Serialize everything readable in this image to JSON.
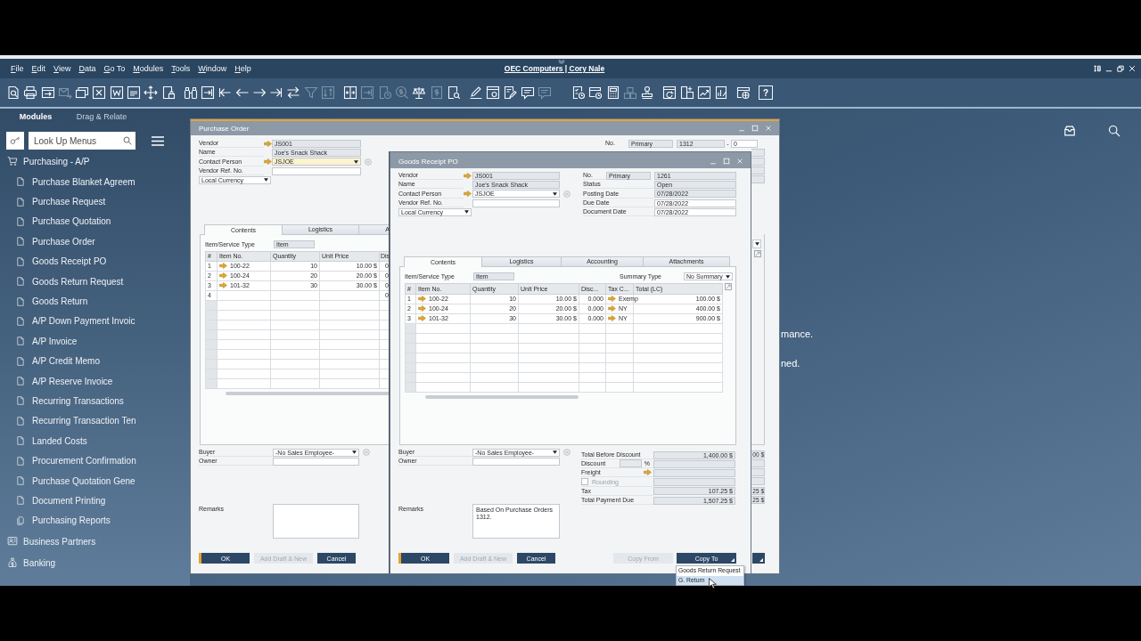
{
  "menu_bar": {
    "items": [
      "File",
      "Edit",
      "View",
      "Data",
      "Go To",
      "Modules",
      "Tools",
      "Window",
      "Help"
    ],
    "title": "OEC Computers | Cory Nale"
  },
  "toolbar": {
    "groups": [
      [
        {
          "disabled": false
        },
        {
          "disabled": false
        },
        {
          "disabled": false
        },
        {
          "disabled": true
        },
        {
          "disabled": false
        },
        {
          "disabled": false
        },
        {
          "disabled": false
        },
        {
          "disabled": false
        },
        {
          "disabled": false
        },
        {
          "disabled": false
        }
      ],
      [
        {
          "disabled": false
        },
        {
          "disabled": false
        },
        {
          "disabled": false
        },
        {
          "disabled": false
        },
        {
          "disabled": false
        },
        {
          "disabled": false
        },
        {
          "disabled": false
        },
        {
          "disabled": true
        },
        {
          "disabled": true
        }
      ],
      [
        {
          "disabled": false
        },
        {
          "disabled": true
        },
        {
          "disabled": true
        },
        {
          "disabled": true
        },
        {
          "disabled": false
        },
        {
          "disabled": true
        },
        {
          "disabled": false
        }
      ],
      [
        {
          "disabled": false
        },
        {
          "disabled": false
        },
        {
          "disabled": false
        },
        {
          "disabled": false
        },
        {
          "disabled": true
        }
      ],
      [
        {
          "disabled": false
        },
        {
          "disabled": false
        },
        {
          "disabled": false
        },
        {
          "disabled": true
        },
        {
          "disabled": false
        }
      ],
      [
        {
          "disabled": false
        },
        {
          "disabled": false
        },
        {
          "disabled": false
        },
        {
          "disabled": false
        }
      ],
      [
        {
          "disabled": false
        }
      ]
    ],
    "help": "?"
  },
  "sidebar": {
    "tabs": [
      {
        "label": "Modules",
        "selected": true
      },
      {
        "label": "Drag & Relate",
        "selected": false
      }
    ],
    "search": {
      "placeholder": "Look Up Menus"
    },
    "modules": [
      {
        "label": "Purchasing - A/P",
        "children": [
          {
            "label": "Purchase Blanket Agreem",
            "kind": "form"
          },
          {
            "label": "Purchase Request",
            "kind": "form"
          },
          {
            "label": "Purchase Quotation",
            "kind": "form"
          },
          {
            "label": "Purchase Order",
            "kind": "form"
          },
          {
            "label": "Goods Receipt PO",
            "kind": "form"
          },
          {
            "label": "Goods Return Request",
            "kind": "form"
          },
          {
            "label": "Goods Return",
            "kind": "form"
          },
          {
            "label": "A/P Down Payment Invoic",
            "kind": "form"
          },
          {
            "label": "A/P Invoice",
            "kind": "form"
          },
          {
            "label": "A/P Credit Memo",
            "kind": "form"
          },
          {
            "label": "A/P Reserve Invoice",
            "kind": "form"
          },
          {
            "label": "Recurring Transactions",
            "kind": "form"
          },
          {
            "label": "Recurring Transaction Ten",
            "kind": "form"
          },
          {
            "label": "Landed Costs",
            "kind": "form"
          },
          {
            "label": "Procurement Confirmation",
            "kind": "form"
          },
          {
            "label": "Purchase Quotation Gene",
            "kind": "form"
          },
          {
            "label": "Document Printing",
            "kind": "form"
          },
          {
            "label": "Purchasing Reports",
            "kind": "folder"
          }
        ]
      },
      {
        "label": "Business Partners"
      },
      {
        "label": "Banking"
      }
    ]
  },
  "background_text": [
    "mance.",
    "ned."
  ],
  "purchase_order": {
    "title": "Purchase Order",
    "active": true,
    "header": [
      {
        "label": "Vendor",
        "link": true,
        "kind": "text",
        "readonly": true,
        "focused": false,
        "value": "JS001"
      },
      {
        "label": "Name",
        "link": false,
        "kind": "text",
        "readonly": true,
        "focused": false,
        "value": "Joe's Snack Shack"
      },
      {
        "label": "Contact Person",
        "link": true,
        "kind": "select",
        "readonly": false,
        "focused": true,
        "value": "JSJOE"
      },
      {
        "label": "Vendor Ref. No.",
        "link": false,
        "kind": "text",
        "readonly": false,
        "focused": false
      }
    ],
    "currency": "Local Currency",
    "number": {
      "label": "No.",
      "series": "Primary",
      "value": "1312",
      "separator": "-",
      "sequence": "0"
    },
    "tabs": [
      {
        "label": "Contents",
        "selected": true
      },
      {
        "label": "Logistics",
        "selected": false
      },
      {
        "label": "A",
        "selected": false
      }
    ],
    "item_type": {
      "label": "Item/Service Type",
      "value": "Item"
    },
    "table": {
      "columns": [
        "#",
        "Item No.",
        "Quantity",
        "Unit Price",
        "Dis"
      ],
      "rows": [
        {
          "num": "1",
          "item": "100-22",
          "quantity": "10",
          "price": "10.00 $",
          "discount": "0"
        },
        {
          "num": "2",
          "item": "100-24",
          "quantity": "20",
          "price": "20.00 $",
          "discount": "0"
        },
        {
          "num": "3",
          "item": "101-32",
          "quantity": "30",
          "price": "30.00 $",
          "discount": "0"
        },
        {
          "num": "4",
          "discount": "0"
        }
      ]
    },
    "buyer": {
      "label": "Buyer",
      "value": "-No Sales Employee-"
    },
    "owner": {
      "label": "Owner"
    },
    "remarks": {
      "label": "Remarks"
    },
    "buttons": [
      {
        "label": "OK",
        "kind": "default"
      },
      {
        "label": "Add Draft & New",
        "kind": "disabled"
      },
      {
        "label": "Cancel",
        "kind": "normal"
      }
    ],
    "right_edge": {
      "header_fields": [
        {
          "kind": "field"
        },
        {
          "kind": "field"
        },
        {
          "kind": "field"
        },
        {
          "kind": "field"
        }
      ],
      "panel_controls": [
        {
          "kind": "dropdown"
        },
        {
          "kind": "expand"
        }
      ],
      "total_fields": [
        {
          "kind": "field",
          "value": "00 $"
        },
        {
          "kind": "field"
        },
        {
          "kind": "field"
        },
        {
          "kind": "field"
        },
        {
          "kind": "field",
          "value": "25 $"
        },
        {
          "kind": "field",
          "value": "25 $"
        }
      ],
      "buttons": [
        {
          "kind": "menu"
        }
      ]
    }
  },
  "goods_receipt_po": {
    "title": "Goods Receipt PO",
    "active": false,
    "header": [
      {
        "label": "Vendor",
        "link": true,
        "kind": "text",
        "readonly": true,
        "focused": false,
        "value": "JS001"
      },
      {
        "label": "Name",
        "link": false,
        "kind": "text",
        "readonly": true,
        "focused": false,
        "value": "Joe's Snack Shack"
      },
      {
        "label": "Contact Person",
        "link": true,
        "kind": "select",
        "readonly": false,
        "focused": false,
        "value": "JSJOE"
      },
      {
        "label": "Vendor Ref. No.",
        "link": false,
        "kind": "text",
        "readonly": false,
        "focused": false
      }
    ],
    "currency": "Local Currency",
    "info": [
      {
        "label": "No.",
        "series": "Primary",
        "value": "1261",
        "readonly": true
      },
      {
        "label": "Status",
        "value": "Open",
        "readonly": true
      },
      {
        "label": "Posting Date",
        "value": "07/28/2022",
        "readonly": true
      },
      {
        "label": "Due Date",
        "value": "07/28/2022",
        "readonly": false
      },
      {
        "label": "Document Date",
        "value": "07/28/2022",
        "readonly": false
      }
    ],
    "tabs": [
      {
        "label": "Contents",
        "selected": true
      },
      {
        "label": "Logistics",
        "selected": false
      },
      {
        "label": "Accounting",
        "selected": false
      },
      {
        "label": "Attachments",
        "selected": false
      }
    ],
    "item_type": {
      "label": "Item/Service Type",
      "value": "Item"
    },
    "summary_type": {
      "label": "Summary Type",
      "value": "No Summary"
    },
    "table": {
      "columns": [
        "#",
        "Item No.",
        "Quantity",
        "Unit Price",
        "Disc...",
        "Tax C...",
        "Total (LC)"
      ],
      "rows": [
        {
          "num": "1",
          "item": "100-22",
          "quantity": "10",
          "price": "10.00 $",
          "discount": "0.000",
          "tax": "Exemp",
          "total": "100.00 $"
        },
        {
          "num": "2",
          "item": "100-24",
          "quantity": "20",
          "price": "20.00 $",
          "discount": "0.000",
          "tax": "NY",
          "total": "400.00 $"
        },
        {
          "num": "3",
          "item": "101-32",
          "quantity": "30",
          "price": "30.00 $",
          "discount": "0.000",
          "tax": "NY",
          "total": "900.00 $"
        }
      ]
    },
    "buyer": {
      "label": "Buyer",
      "value": "-No Sales Employee-"
    },
    "owner": {
      "label": "Owner"
    },
    "remarks": {
      "label": "Remarks",
      "value": "Based On Purchase Orders 1312."
    },
    "totals": [
      {
        "label": "Total Before Discount",
        "kind": "amount",
        "disabled": false,
        "value": "1,400.00 $"
      },
      {
        "label": "Discount",
        "kind": "percent",
        "disabled": false,
        "unit": "%"
      },
      {
        "label": "Freight",
        "kind": "link",
        "disabled": false
      },
      {
        "label": "Rounding",
        "kind": "checkbox",
        "disabled": true,
        "checked": false
      },
      {
        "label": "Tax",
        "kind": "amount",
        "disabled": false,
        "value": "107.25 $"
      },
      {
        "label": "Total Payment Due",
        "kind": "amount",
        "disabled": false,
        "value": "1,507.25 $"
      }
    ],
    "buttons": [
      {
        "label": "OK",
        "kind": "default"
      },
      {
        "label": "Add Draft & New",
        "kind": "disabled"
      },
      {
        "label": "Cancel",
        "kind": "normal"
      }
    ],
    "copy_buttons": [
      {
        "label": "Copy From",
        "kind": "disabled"
      },
      {
        "label": "Copy To",
        "kind": "menu"
      }
    ],
    "copy_menu": [
      {
        "label": "Goods Return Request",
        "selected": false
      },
      {
        "label": "G. Return",
        "selected": true
      }
    ]
  }
}
